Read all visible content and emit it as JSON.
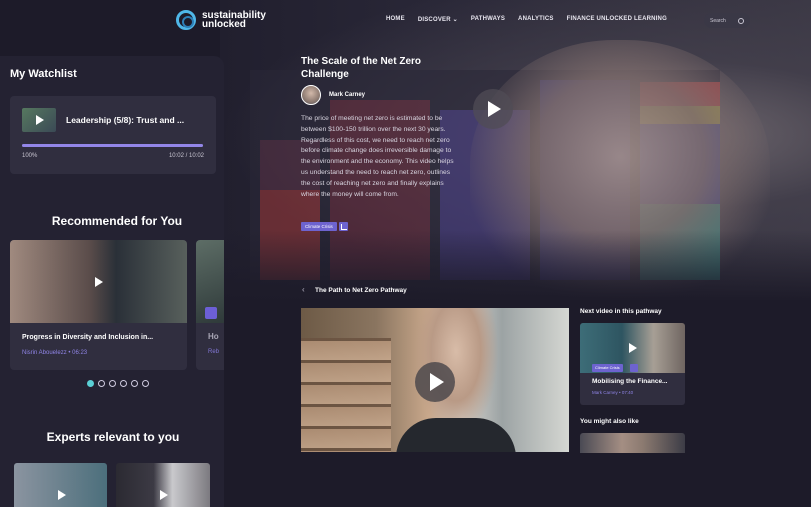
{
  "header": {
    "logo_line1": "sustainability",
    "logo_line2": "unlocked",
    "nav": [
      "HOME",
      "DISCOVER ⌄",
      "PATHWAYS",
      "ANALYTICS",
      "FINANCE UNLOCKED LEARNING"
    ],
    "search_placeholder": "Search"
  },
  "watchlist": {
    "title": "My Watchlist",
    "item": {
      "label": "Leadership (5/8): Trust and ...",
      "progress_percent": 100,
      "progress_text": "100%",
      "time": "10:02 / 10:02"
    }
  },
  "recommended": {
    "title": "Recommended for You",
    "cards": [
      {
        "title": "Progress in Diversity and Inclusion in...",
        "meta": "Nisrin Abouelezz • 06:23"
      },
      {
        "title": "Ho",
        "meta": "Reb"
      }
    ],
    "dots": 6,
    "active_dot": 0
  },
  "experts": {
    "title": "Experts relevant to you"
  },
  "video": {
    "title": "The Scale of the Net Zero Challenge",
    "author": "Mark Carney",
    "description": "The price of meeting net zero is estimated to be between $100-150 trillion over the next 30 years. Regardless of this cost, we need to reach net zero before climate change does irreversible damage to the environment and the economy. This video helps us understand the need to reach net zero, outlines the cost of reaching net zero and finally explains where the money will come from.",
    "tag": "Climate Crisis"
  },
  "pathway": {
    "back": "‹",
    "title": "The Path to Net Zero Pathway",
    "next_label": "Next video in this pathway",
    "next": {
      "tag": "Climate Crisis",
      "title": "Mobilising the Finance...",
      "meta": "Mark Carney • 07:40"
    },
    "also_label": "You might also like"
  },
  "colors": {
    "background": "#1d1b29",
    "panel": "#242232",
    "card": "#302e3f",
    "accent_purple": "#6d63cf",
    "accent_teal": "#5bd0d6"
  }
}
